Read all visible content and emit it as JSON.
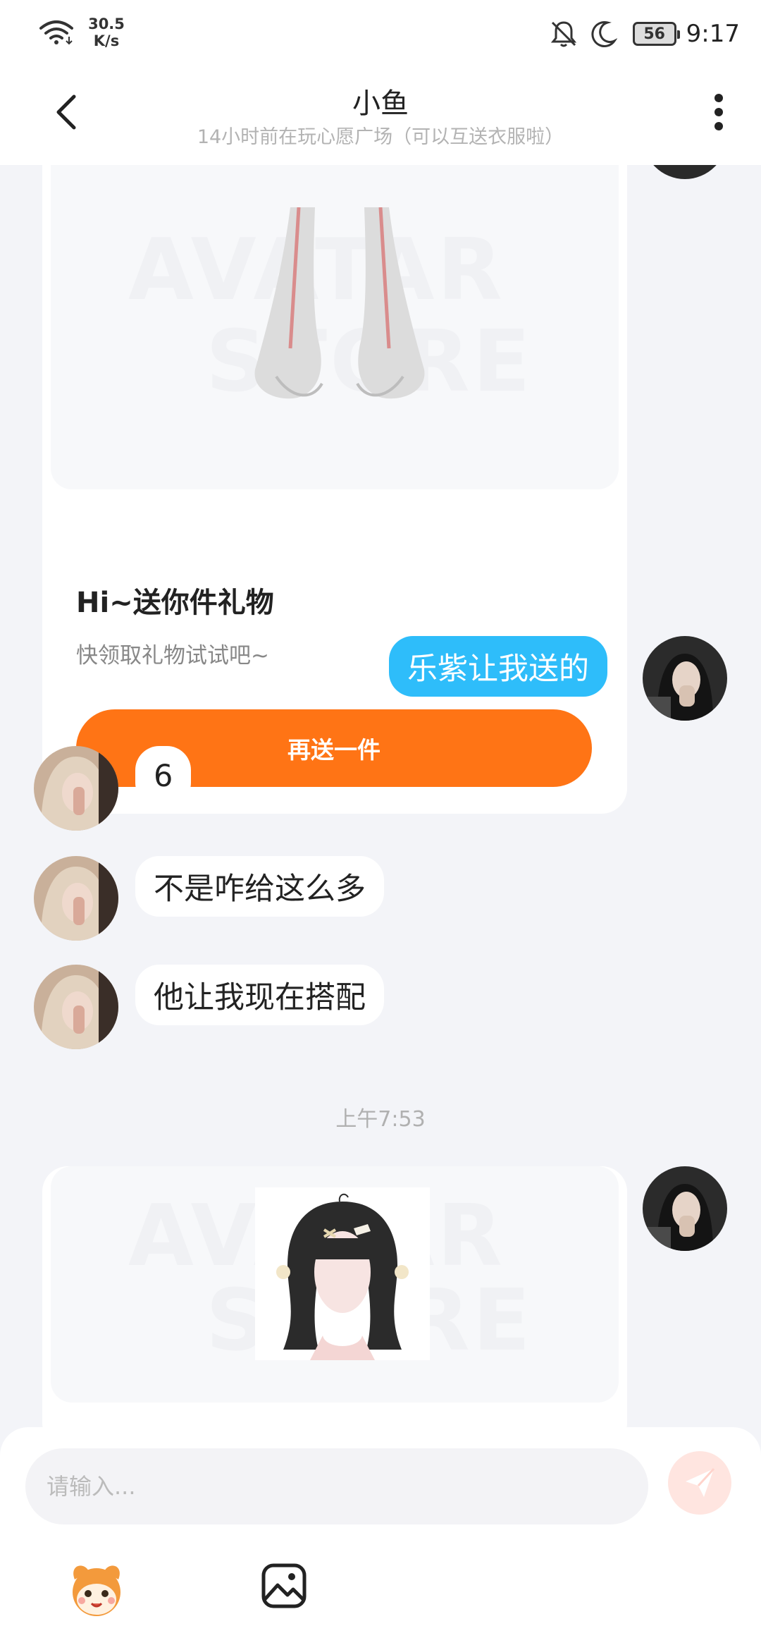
{
  "status_bar": {
    "speed_value": "30.5",
    "speed_unit": "K/s",
    "battery": "56",
    "time": "9:17"
  },
  "header": {
    "title": "小鱼",
    "subtitle": "14小时前在玩心愿广场（可以互送衣服啦）"
  },
  "gift_card_1": {
    "watermark_line1": "AVATAR",
    "watermark_line2": "STORE",
    "title": "Hi~送你件礼物",
    "description": "快领取礼物试试吧~",
    "button_label": "再送一件"
  },
  "messages": [
    {
      "direction": "out",
      "text": "乐紫让我送的"
    },
    {
      "direction": "in",
      "text": "6"
    },
    {
      "direction": "in",
      "text": "不是咋给这么多"
    },
    {
      "direction": "in",
      "text": "他让我现在搭配"
    }
  ],
  "time_label": "上午7:53",
  "gift_card_2": {
    "watermark_line1": "AVATAR",
    "watermark_line2": "STORE"
  },
  "input": {
    "placeholder": "请输入..."
  },
  "icons": {
    "wifi": "wifi-icon",
    "bell": "bell-off-icon",
    "moon": "moon-icon",
    "back": "chevron-left-icon",
    "more": "more-vertical-icon",
    "send": "send-icon",
    "mascot": "mascot-emoji-icon",
    "image": "image-icon"
  },
  "colors": {
    "accent_orange": "#ff7415",
    "outgoing_bubble": "#2ebdfa",
    "background": "#f3f4f8"
  }
}
